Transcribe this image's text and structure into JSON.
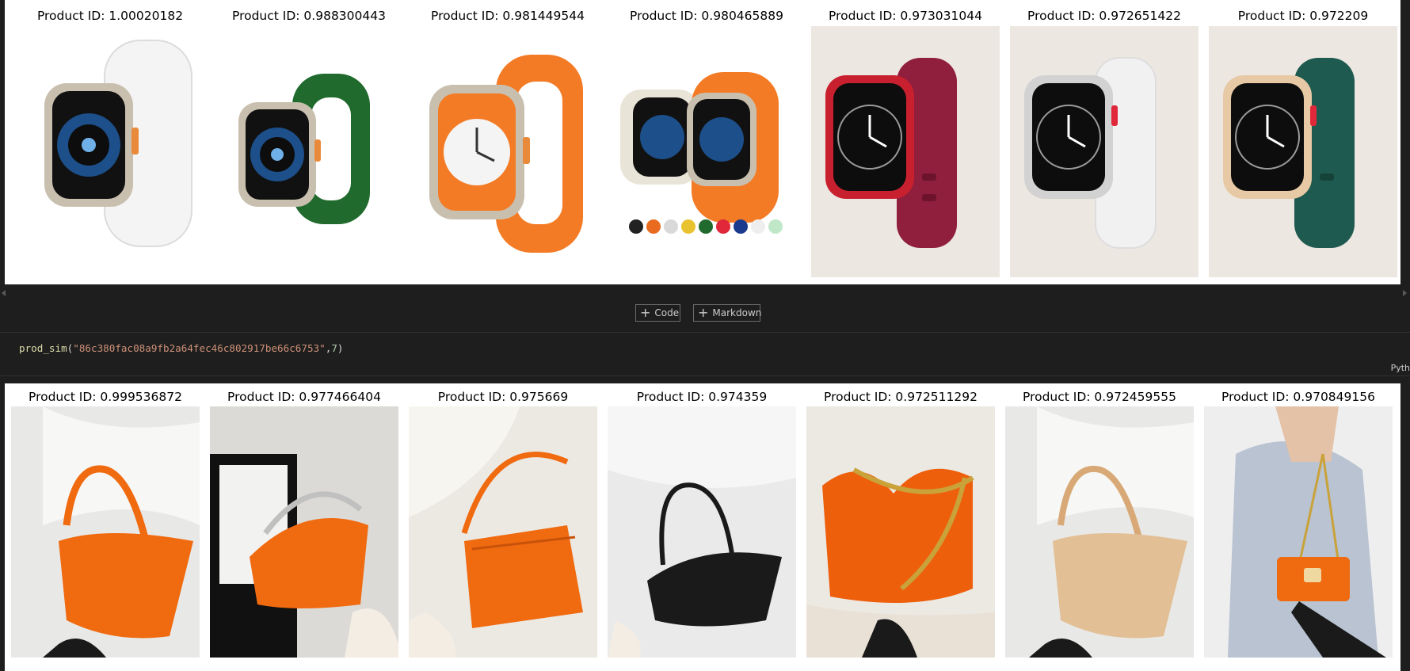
{
  "cell_toolbar": {
    "add_code_label": "Code",
    "add_markdown_label": "Markdown"
  },
  "code_cell": {
    "function": "prod_sim",
    "open_paren": "(",
    "string_arg": "\"86c380fac08a9fb2a64fec46c802917be66c6753\"",
    "separator": ",",
    "number_arg": "7",
    "close_paren": ")",
    "language_label": "Pyth"
  },
  "output_watches": {
    "items": [
      {
        "title": "Product ID: 1.00020182",
        "band_color": "#f4f4f4",
        "case_color": "#c9bfae"
      },
      {
        "title": "Product ID: 0.988300443",
        "band_color": "#1f6a2c",
        "case_color": "#c9bfae"
      },
      {
        "title": "Product ID: 0.981449544",
        "band_color": "#f47b25",
        "case_color": "#c9bfae"
      },
      {
        "title": "Product ID: 0.980465889",
        "band_color": "#f47b25",
        "case_color": "#c9bfae"
      },
      {
        "title": "Product ID: 0.973031044",
        "band_color": "#8f1f3c",
        "case_color": "#c8202e"
      },
      {
        "title": "Product ID: 0.972651422",
        "band_color": "#f1f1f1",
        "case_color": "#d2d2d2"
      },
      {
        "title": "Product ID: 0.972209",
        "band_color": "#1e5a4f",
        "case_color": "#e7c9a5"
      }
    ]
  },
  "output_bags": {
    "items": [
      {
        "title": "Product ID: 0.999536872",
        "bag_color": "#f06a10"
      },
      {
        "title": "Product ID: 0.977466404",
        "bag_color": "#f06a10"
      },
      {
        "title": "Product ID: 0.975669",
        "bag_color": "#f06a10"
      },
      {
        "title": "Product ID: 0.974359",
        "bag_color": "#1a1a1a"
      },
      {
        "title": "Product ID: 0.972511292",
        "bag_color": "#ee5f0c"
      },
      {
        "title": "Product ID: 0.972459555",
        "bag_color": "#e3bf95"
      },
      {
        "title": "Product ID: 0.970849156",
        "bag_color": "#f06a10"
      }
    ]
  },
  "colors": {
    "editor_background": "#1e1e1e",
    "output_background": "#ffffff",
    "code_function": "#dcdcaa",
    "code_string": "#ce9178",
    "code_number": "#b5cea8"
  }
}
